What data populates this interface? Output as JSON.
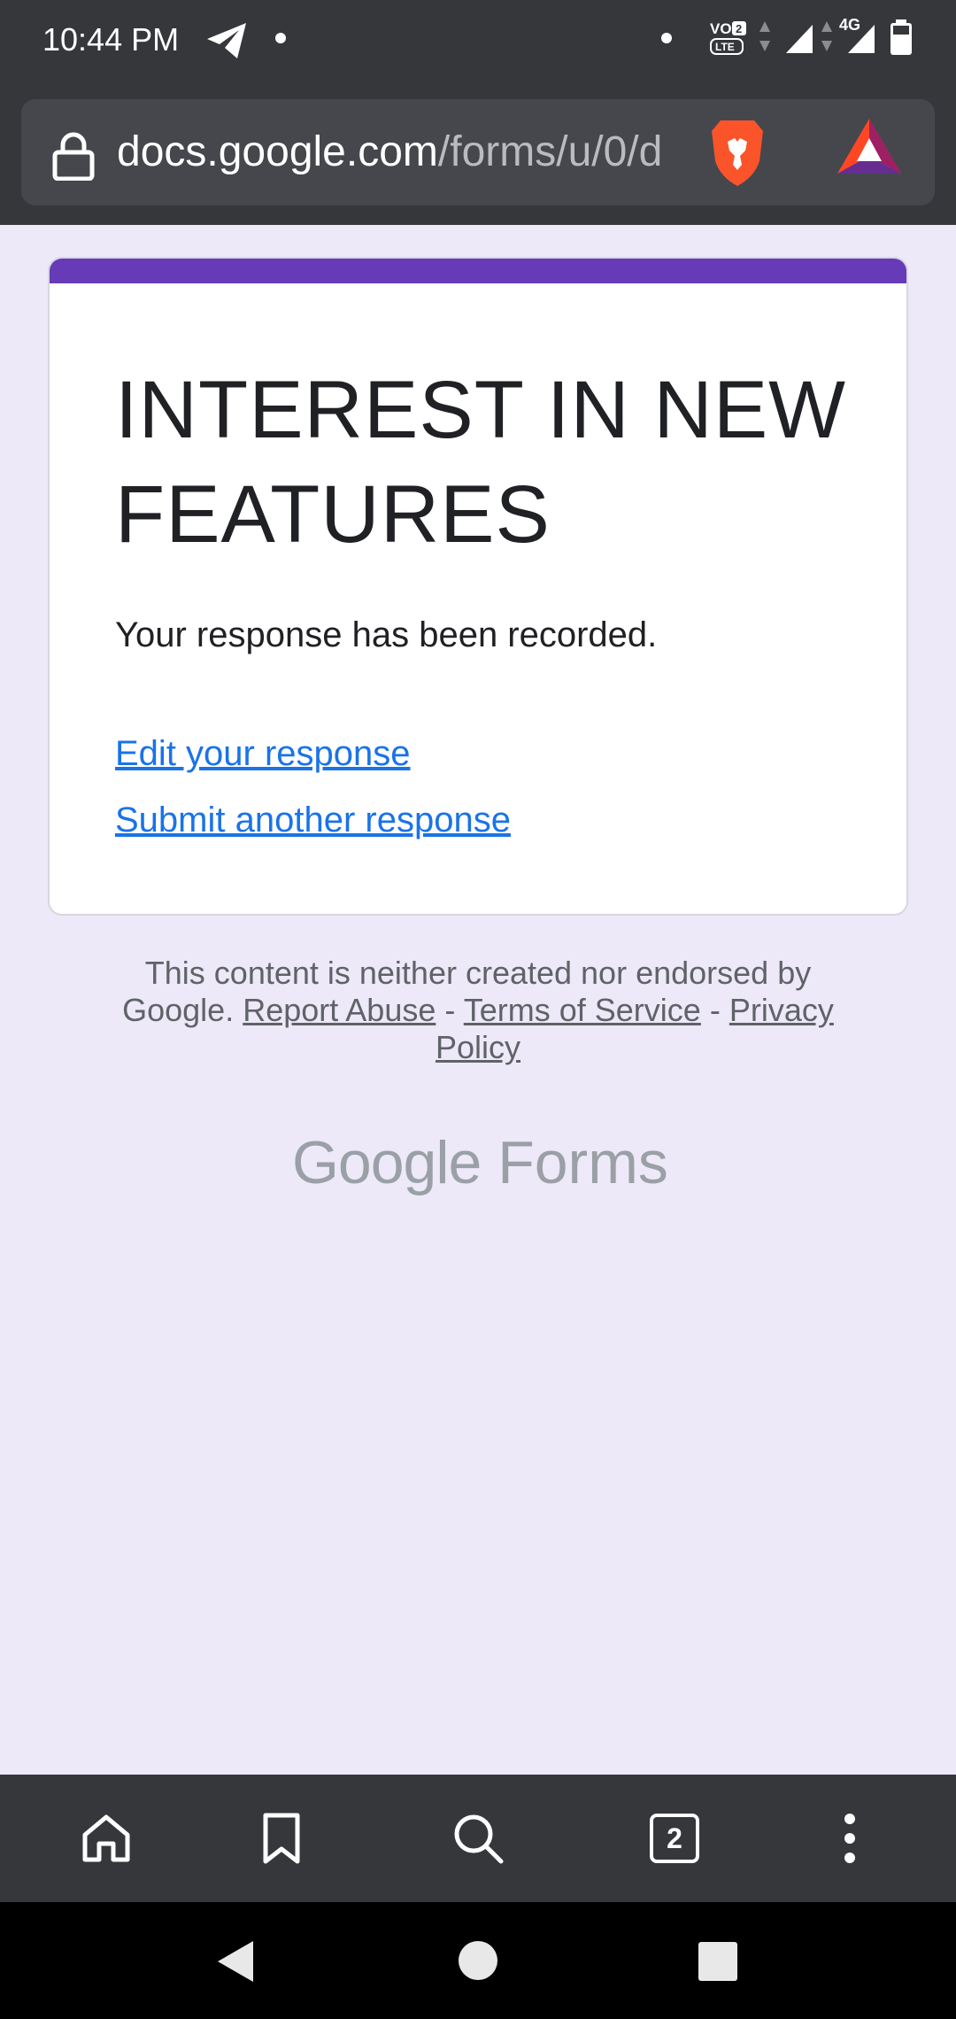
{
  "status_bar": {
    "time": "10:44 PM",
    "network_label": "4G",
    "volte_label": "VO LTE",
    "volte_sim": "2"
  },
  "browser": {
    "url_domain": "docs.google.com",
    "url_path": "/forms/u/0/d"
  },
  "form": {
    "accent_color": "#673ab7",
    "title": "INTEREST IN NEW FEATURES",
    "confirmation": "Your response has been recorded.",
    "edit_link": "Edit your response",
    "submit_another_link": "Submit another response"
  },
  "footer": {
    "disclaimer": "This content is neither created nor endorsed by Google.",
    "report_abuse": "Report Abuse",
    "separator": "-",
    "terms": "Terms of Service",
    "privacy": "Privacy Policy"
  },
  "logo": {
    "google": "Google",
    "forms": "Forms"
  },
  "toolbar": {
    "tab_count": "2"
  },
  "colors": {
    "page_background": "#ede9f8",
    "chrome_dark": "#35373b",
    "link_blue": "#1a73e8"
  }
}
